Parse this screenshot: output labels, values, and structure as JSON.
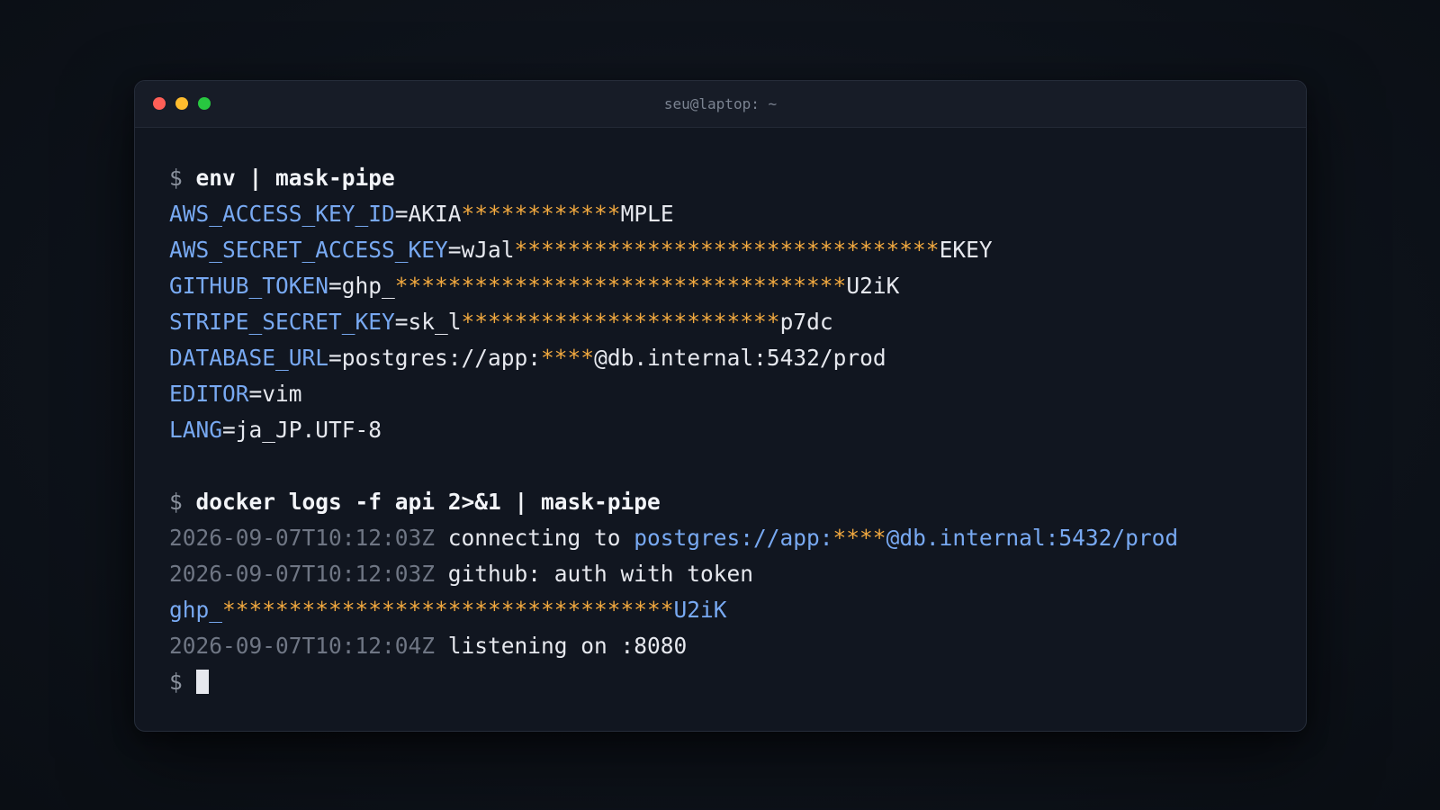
{
  "window": {
    "title": "seu@laptop: ~",
    "controls": [
      "close",
      "minimize",
      "maximize"
    ]
  },
  "colors": {
    "background": "#0e131b",
    "terminal_bg": "#111620",
    "key": "#78a9f2",
    "mask": "#f2a93f",
    "text": "#e6e8ee",
    "muted": "#6f7684",
    "close": "#ff5f57",
    "minimize": "#febc2e",
    "maximize": "#28c840"
  },
  "terminal": {
    "prompt": "$ ",
    "block1": {
      "command": "env | mask-pipe",
      "lines": [
        {
          "key": "AWS_ACCESS_KEY_ID",
          "eq": "=",
          "prefix": "AKIA",
          "mask": "************",
          "suffix": "MPLE"
        },
        {
          "key": "AWS_SECRET_ACCESS_KEY",
          "eq": "=",
          "prefix": "wJal",
          "mask": "********************************",
          "suffix": "EKEY"
        },
        {
          "key": "GITHUB_TOKEN",
          "eq": "=",
          "prefix": "ghp_",
          "mask": "**********************************",
          "suffix": "U2iK"
        },
        {
          "key": "STRIPE_SECRET_KEY",
          "eq": "=",
          "prefix": "sk_l",
          "mask": "************************",
          "suffix": "p7dc"
        },
        {
          "key": "DATABASE_URL",
          "eq": "=",
          "prefix": "postgres://app:",
          "mask": "****",
          "suffix": "@db.internal:5432/prod"
        },
        {
          "key": "EDITOR",
          "eq": "=",
          "value": "vim"
        },
        {
          "key": "LANG",
          "eq": "=",
          "value": "ja_JP.UTF-8"
        }
      ]
    },
    "block2": {
      "command": "docker logs -f api 2>&1 | mask-pipe",
      "log1": {
        "ts": "2026-09-07T10:12:03Z",
        "msg": " connecting to ",
        "url_prefix": "postgres://app:",
        "mask": "****",
        "url_suffix": "@db.internal:5432/prod"
      },
      "log2": {
        "ts": "2026-09-07T10:12:03Z",
        "msg": " github: auth with token"
      },
      "log2_cont": {
        "prefix": "ghp_",
        "mask": "**********************************",
        "suffix": "U2iK"
      },
      "log3": {
        "ts": "2026-09-07T10:12:04Z",
        "msg": " listening on :8080"
      }
    }
  }
}
